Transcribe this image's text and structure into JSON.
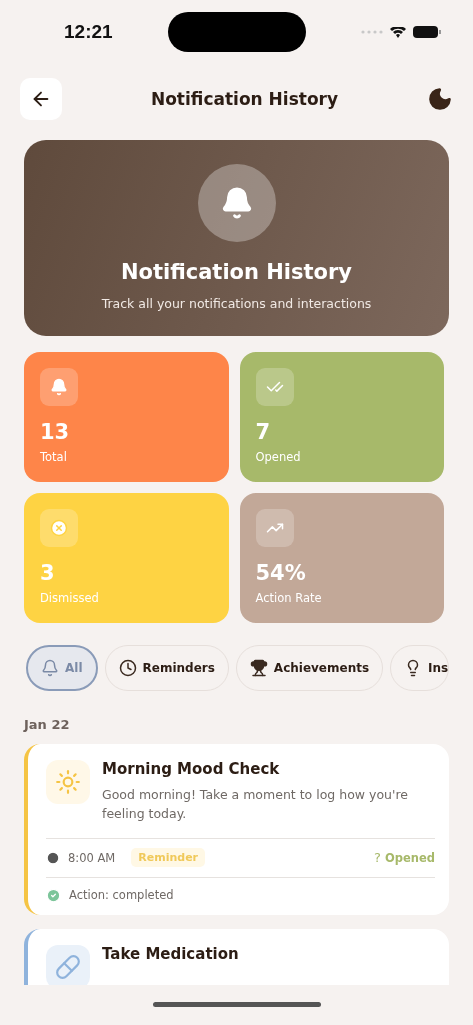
{
  "status_bar": {
    "time": "12:21"
  },
  "header": {
    "title": "Notification History"
  },
  "hero": {
    "title": "Notification History",
    "subtitle": "Track all your notifications and interactions"
  },
  "stats": [
    {
      "kind": "total",
      "value": "13",
      "label": "Total",
      "color": "#fe8549"
    },
    {
      "kind": "opened",
      "value": "7",
      "label": "Opened",
      "color": "#a7b96a"
    },
    {
      "kind": "dismissed",
      "value": "3",
      "label": "Dismissed",
      "color": "#fed343"
    },
    {
      "kind": "rate",
      "value": "54%",
      "label": "Action Rate",
      "color": "#c2a898"
    }
  ],
  "filters": [
    {
      "kind": "all",
      "label": "All",
      "selected": true
    },
    {
      "kind": "reminders",
      "label": "Reminders",
      "selected": false
    },
    {
      "kind": "achievements",
      "label": "Achievements",
      "selected": false
    },
    {
      "kind": "insights",
      "label": "Ins",
      "selected": false
    }
  ],
  "groups": [
    {
      "date": "Jan 22",
      "notifications": [
        {
          "kind": "mood",
          "color": "#f5c444",
          "title": "Morning Mood Check",
          "message": "Good morning! Take a moment to log how you're feeling today.",
          "time": "8:00 AM",
          "tag": "Reminder",
          "status_mark": "?",
          "status": "Opened",
          "action": "Action: completed"
        },
        {
          "kind": "medication",
          "color": "#8fb3dc",
          "title": "Take Medication"
        }
      ]
    }
  ]
}
